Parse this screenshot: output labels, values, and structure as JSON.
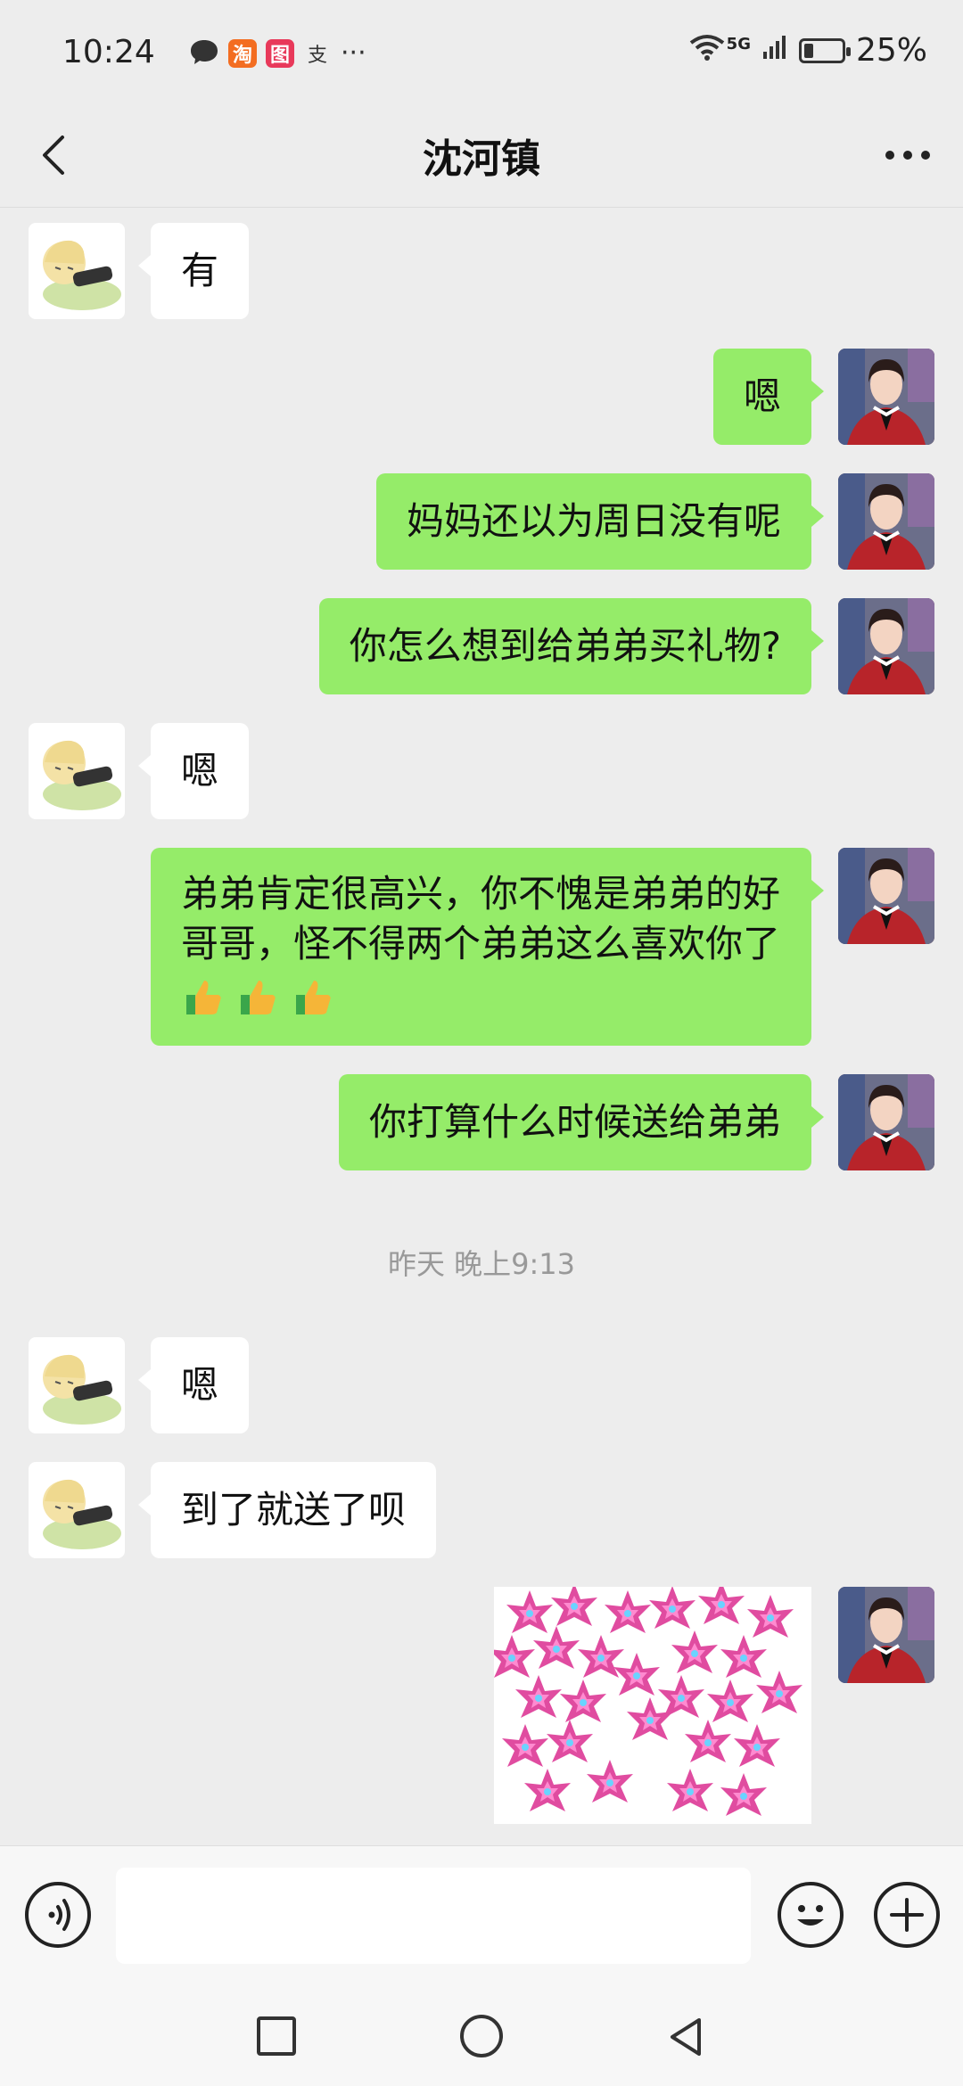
{
  "status_bar": {
    "time": "10:24",
    "network": "5G",
    "battery": "25%",
    "battery_level": 0.25,
    "notification_icons": [
      "message-icon",
      "taobao-icon",
      "app-icon",
      "alipay-icon",
      "more-dots-icon"
    ],
    "notification_glyphs": [
      "淘",
      "图",
      "支"
    ]
  },
  "header": {
    "title": "沈河镇"
  },
  "messages": [
    {
      "side": "them",
      "text": "有"
    },
    {
      "side": "me",
      "text": "嗯"
    },
    {
      "side": "me",
      "text": "妈妈还以为周日没有呢"
    },
    {
      "side": "me",
      "text": "你怎么想到给弟弟买礼物?"
    },
    {
      "side": "them",
      "text": "嗯"
    },
    {
      "side": "me",
      "text": "弟弟肯定很高兴，你不愧是弟弟的好哥哥，怪不得两个弟弟这么喜欢你了"
    },
    {
      "side": "me",
      "text": "你打算什么时候送给弟弟"
    },
    {
      "side": "them",
      "text": "嗯"
    },
    {
      "side": "them",
      "text": "到了就送了呗"
    },
    {
      "side": "me",
      "type": "sticker",
      "text": "",
      "sticker": "pink-flower-text-sticker"
    }
  ],
  "timestamp": "昨天 晚上9:13",
  "input": {
    "placeholder": ""
  },
  "colors": {
    "background": "#ededed",
    "bubble_me": "#95ec69",
    "bubble_them": "#ffffff",
    "sticker_pink": "#e04ca0"
  }
}
